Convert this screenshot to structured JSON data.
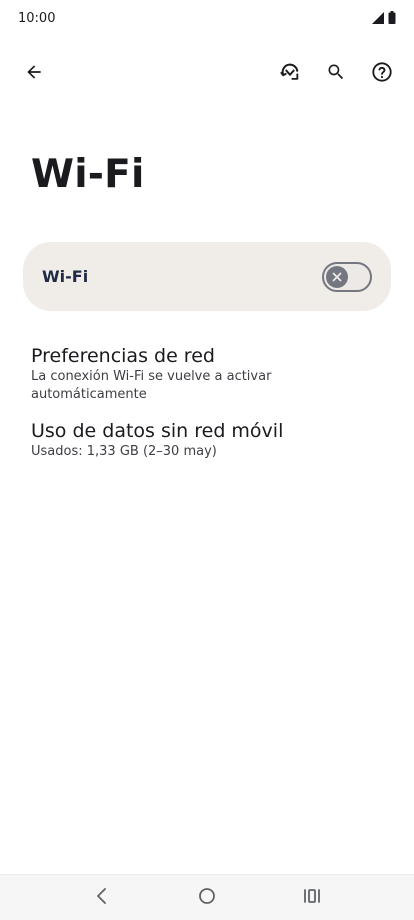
{
  "status_bar": {
    "time": "10:00",
    "icons": [
      "signal-icon",
      "battery-icon"
    ]
  },
  "toolbar": {
    "back_icon": "back-arrow-icon",
    "actions": [
      "wifi-refresh-icon",
      "search-icon",
      "help-icon"
    ]
  },
  "page": {
    "title": "Wi-Fi"
  },
  "main_switch": {
    "label": "Wi-Fi",
    "state": "off"
  },
  "preferences": [
    {
      "title": "Preferencias de red",
      "summary": "La conexión Wi-Fi se vuelve a activar automáticamente"
    },
    {
      "title": "Uso de datos sin red móvil",
      "summary": "Usados: 1,33 GB (2–30 may)"
    }
  ],
  "nav_bar": {
    "buttons": [
      "nav-back-icon",
      "nav-home-icon",
      "nav-recents-icon"
    ]
  },
  "colors": {
    "card_background": "#f0ece8",
    "switch_off": "#74777f",
    "text_primary": "#1b1b1f"
  }
}
